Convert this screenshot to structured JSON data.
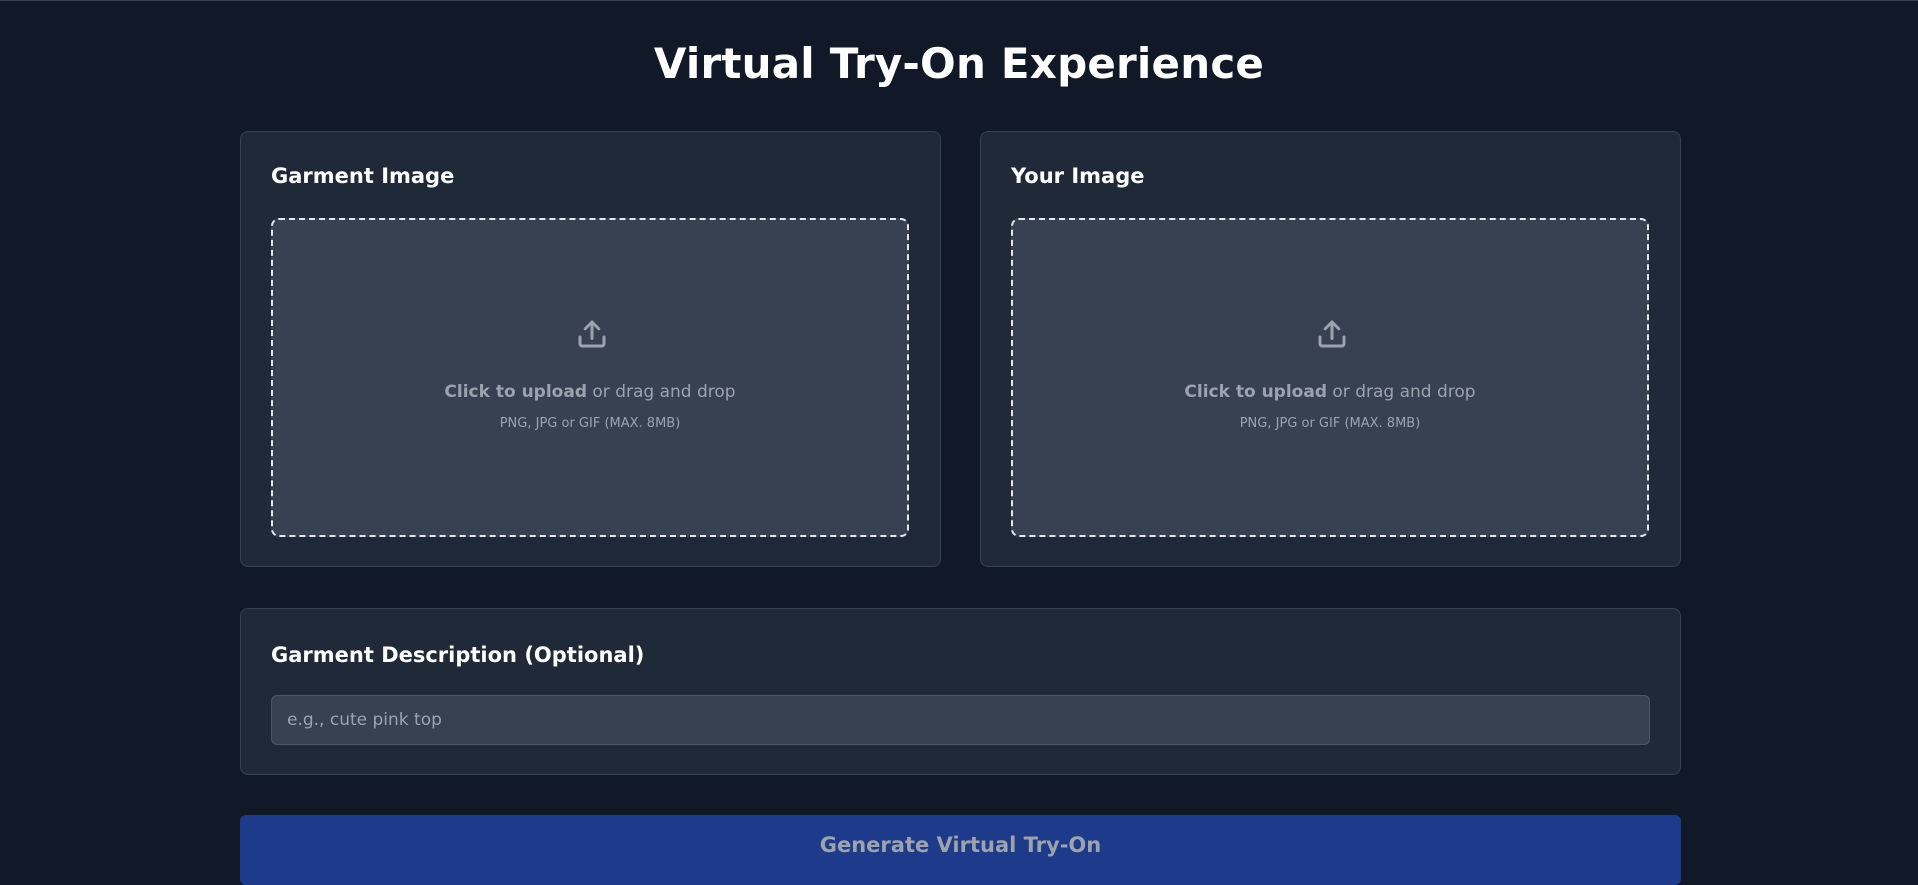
{
  "page": {
    "title": "Virtual Try-On Experience"
  },
  "upload_garment": {
    "title": "Garment Image",
    "cta_bold": "Click to upload",
    "cta_rest": " or drag and drop",
    "hint": "PNG, JPG or GIF (MAX. 8MB)",
    "icon": "upload-icon"
  },
  "upload_person": {
    "title": "Your Image",
    "cta_bold": "Click to upload",
    "cta_rest": " or drag and drop",
    "hint": "PNG, JPG or GIF (MAX. 8MB)",
    "icon": "upload-icon"
  },
  "description": {
    "title": "Garment Description (Optional)",
    "placeholder": "e.g., cute pink top",
    "value": ""
  },
  "generate": {
    "label": "Generate Virtual Try-On"
  },
  "colors": {
    "background": "#111827",
    "card": "#1f2937",
    "dropzone": "#374151",
    "button": "#1e3a8a",
    "muted_text": "#9ca3af"
  }
}
